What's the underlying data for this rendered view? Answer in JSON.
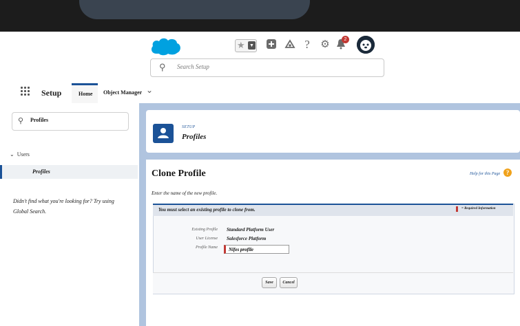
{
  "header": {
    "search_placeholder": "Search Setup",
    "notification_count": "2",
    "icons": [
      "star-icon",
      "plus-icon",
      "trailhead-icon",
      "help-icon",
      "gear-icon",
      "bell-icon",
      "avatar"
    ]
  },
  "app_nav": {
    "app_name": "Setup",
    "tabs": [
      "Home",
      "Object Manager"
    ]
  },
  "sidebar": {
    "quick_find_value": "Profiles",
    "tree": {
      "users_label": "Users",
      "profiles_label": "Profiles"
    },
    "not_found_text": "Didn't find what you're looking for? Try using Global Search."
  },
  "breadcrumb": {
    "section": "SETUP",
    "title": "Profiles"
  },
  "clone_profile": {
    "title": "Clone Profile",
    "help_link": "Help for this Page",
    "instructions": "Enter the name of the new profile.",
    "section_header": "You must select an existing profile to clone from.",
    "required_info": "= Required Information",
    "fields": {
      "existing_profile_label": "Existing Profile",
      "existing_profile_value": "Standard Platform User",
      "user_license_label": "User License",
      "user_license_value": "Salesforce Platform",
      "profile_name_label": "Profile Name",
      "profile_name_value": "Nifes profile"
    },
    "save_label": "Save",
    "cancel_label": "Cancel"
  },
  "colors": {
    "brand_blue": "#1b5297",
    "salesforce_cloud": "#00a1e0",
    "required_red": "#c23934",
    "help_orange": "#f0a21b"
  }
}
